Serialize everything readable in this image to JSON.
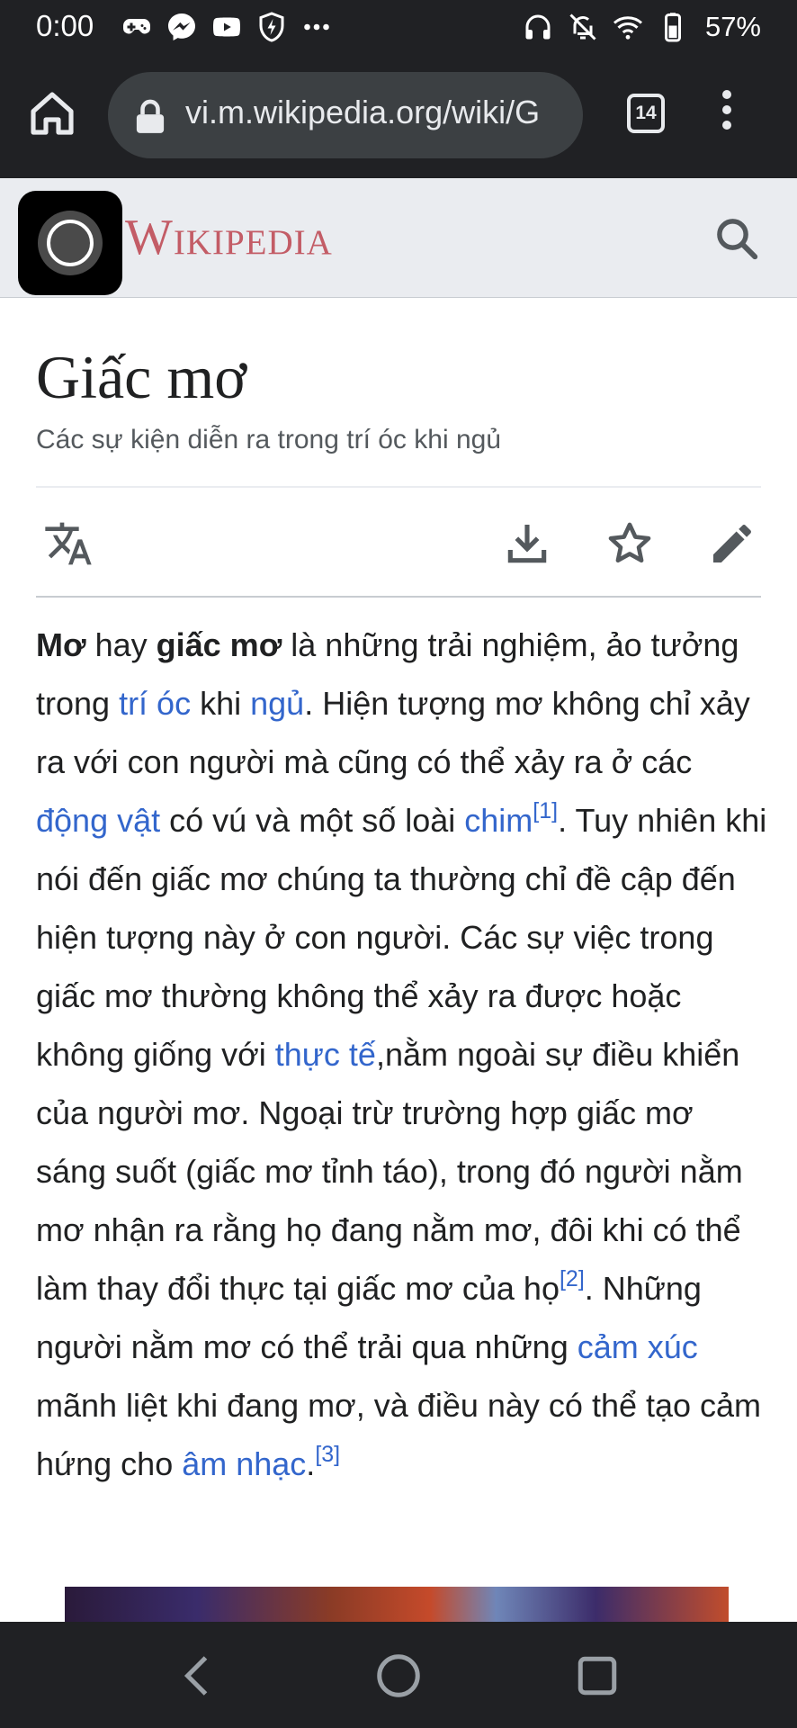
{
  "status_bar": {
    "time": "0:00",
    "left_icons": [
      "gamepad-icon",
      "messenger-icon",
      "youtube-icon",
      "shield-icon",
      "more-icon"
    ],
    "right_icons": [
      "headphones-icon",
      "bell-off-icon",
      "wifi-icon",
      "battery-icon"
    ],
    "battery": "57%"
  },
  "browser": {
    "url": "vi.m.wikipedia.org/wiki/G",
    "tab_count": "14"
  },
  "wiki": {
    "logo": "Wikipedia"
  },
  "article": {
    "title": "Giấc mơ",
    "description": "Các sự kiện diễn ra trong trí óc khi ngủ",
    "paragraph": [
      {
        "t": "b",
        "v": "Mơ"
      },
      {
        "t": "text",
        "v": " hay "
      },
      {
        "t": "b",
        "v": "giấc mơ"
      },
      {
        "t": "text",
        "v": " là những trải nghiệm, ảo tưởng trong "
      },
      {
        "t": "a",
        "v": "trí óc"
      },
      {
        "t": "text",
        "v": " khi "
      },
      {
        "t": "a",
        "v": "ngủ"
      },
      {
        "t": "text",
        "v": ". Hiện tượng mơ không chỉ xảy ra với con người mà cũng có thể xảy ra ở các "
      },
      {
        "t": "a",
        "v": "động vật"
      },
      {
        "t": "text",
        "v": " có vú và một số loài "
      },
      {
        "t": "a",
        "v": "chim"
      },
      {
        "t": "sup",
        "v": "[1]"
      },
      {
        "t": "text",
        "v": ". Tuy nhiên khi nói đến giấc mơ chúng ta thường chỉ đề cập đến hiện tượng này ở con người. Các sự việc trong giấc mơ thường không thể xảy ra được hoặc không giống với "
      },
      {
        "t": "a",
        "v": "thực tế"
      },
      {
        "t": "text",
        "v": ",nằm ngoài sự điều khiển của người mơ. Ngoại trừ trường hợp giấc mơ sáng suốt (giấc mơ tỉnh táo), trong đó người nằm mơ nhận ra rằng họ đang nằm mơ, đôi khi có thể làm thay đổi thực tại giấc mơ của họ"
      },
      {
        "t": "sup",
        "v": "[2]"
      },
      {
        "t": "text",
        "v": ". Những người nằm mơ có thể trải qua những "
      },
      {
        "t": "a",
        "v": "cảm xúc"
      },
      {
        "t": "text",
        "v": " mãnh liệt khi đang mơ, và điều này có thể tạo cảm hứng cho "
      },
      {
        "t": "a",
        "v": "âm nhạc"
      },
      {
        "t": "text",
        "v": "."
      },
      {
        "t": "sup",
        "v": "[3]"
      }
    ]
  },
  "colors": {
    "link": "#3366cc",
    "logo": "#c35c66",
    "chrome_dark": "#202124",
    "header_bg": "#eaecf0"
  }
}
